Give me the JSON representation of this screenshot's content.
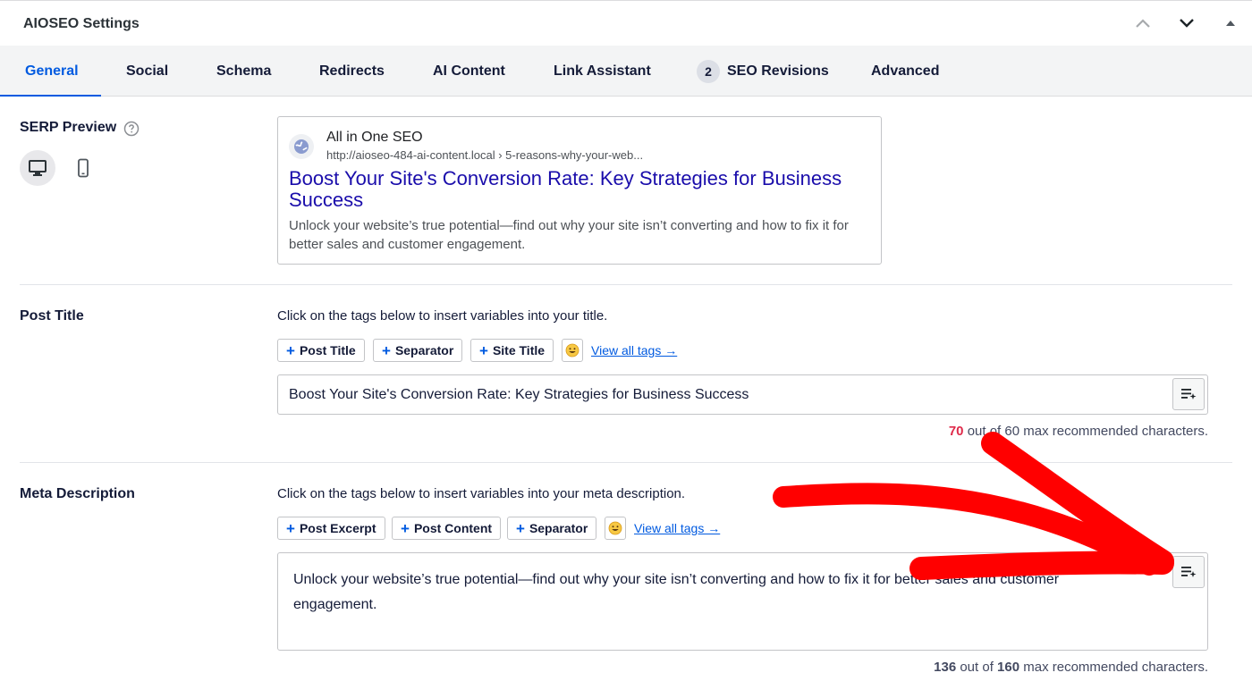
{
  "panel": {
    "title": "AIOSEO Settings"
  },
  "tabs": [
    {
      "label": "General",
      "active": true
    },
    {
      "label": "Social"
    },
    {
      "label": "Schema"
    },
    {
      "label": "Redirects"
    },
    {
      "label": "AI Content"
    },
    {
      "label": "Link Assistant"
    },
    {
      "label": "SEO Revisions",
      "badge": "2"
    },
    {
      "label": "Advanced"
    }
  ],
  "serp": {
    "label": "SERP Preview",
    "site_name": "All in One SEO",
    "url": "http://aioseo-484-ai-content.local › 5-reasons-why-your-web...",
    "title": "Boost Your Site's Conversion Rate: Key Strategies for Business Success",
    "description": "Unlock your website’s true potential—find out why your site isn’t converting and how to fix it for better sales and customer engagement."
  },
  "post_title": {
    "label": "Post Title",
    "instruction": "Click on the tags below to insert variables into your title.",
    "tags": [
      "Post Title",
      "Separator",
      "Site Title"
    ],
    "view_all": "View all tags →",
    "value": "Boost Your Site's Conversion Rate: Key Strategies for Business Success",
    "count": "70",
    "count_suffix": " out of 60 max recommended characters."
  },
  "meta_description": {
    "label": "Meta Description",
    "instruction": "Click on the tags below to insert variables into your meta description.",
    "tags": [
      "Post Excerpt",
      "Post Content",
      "Separator"
    ],
    "view_all": "View all tags →",
    "value": "Unlock your website’s true potential—find out why your site isn’t converting and how to fix it for better sales and customer engagement.",
    "count": "136",
    "count_mid": " out of ",
    "count_max": "160",
    "count_suffix": " max recommended characters."
  },
  "colors": {
    "accent": "#005ae0",
    "link": "#1a0dab",
    "over_limit": "#df2a4a",
    "annotation": "#ff0000"
  },
  "icons": [
    "chevron-up-icon",
    "chevron-down-icon",
    "caret-up-icon",
    "help-icon",
    "desktop-icon",
    "mobile-icon",
    "globe-icon",
    "emoji-icon",
    "ai-generate-icon"
  ]
}
